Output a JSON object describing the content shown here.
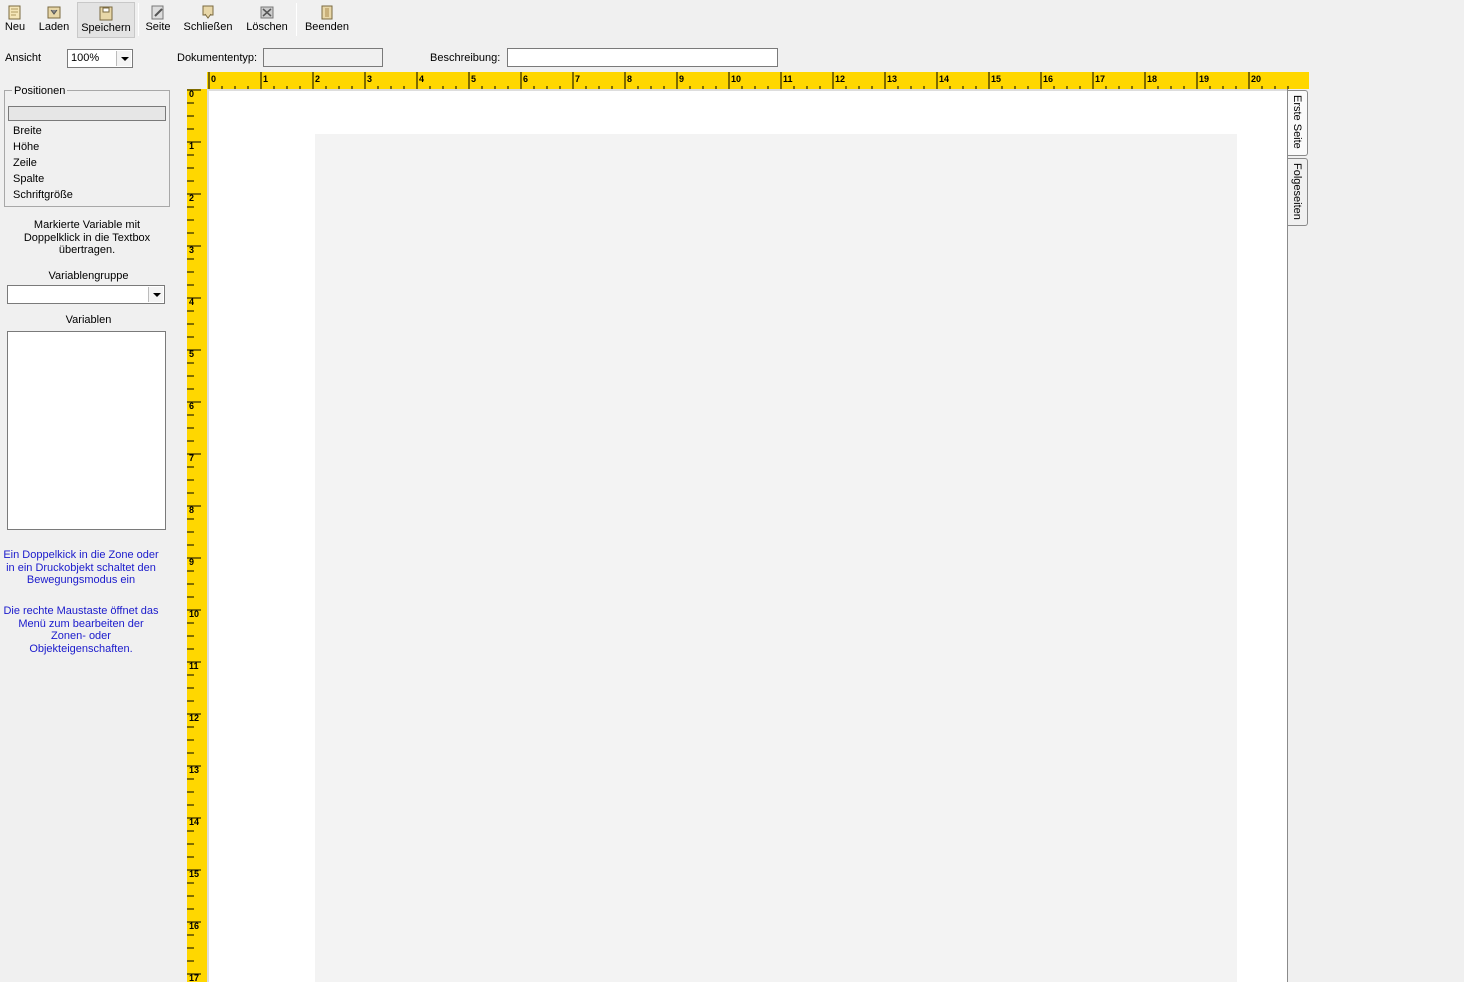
{
  "toolbar": {
    "buttons": [
      {
        "label": "Neu",
        "icon": "new-document-icon"
      },
      {
        "label": "Laden",
        "icon": "load-folder-icon"
      },
      {
        "label": "Speichern",
        "icon": "save-icon"
      },
      {
        "label": "Seite",
        "icon": "page-edit-icon"
      },
      {
        "label": "Schließen",
        "icon": "close-document-icon"
      },
      {
        "label": "Löschen",
        "icon": "delete-icon"
      },
      {
        "label": "Beenden",
        "icon": "exit-door-icon"
      }
    ]
  },
  "fields": {
    "ansicht_label": "Ansicht",
    "ansicht_value": "100%",
    "dokumenttyp_label": "Dokumententyp:",
    "beschreibung_label": "Beschreibung:"
  },
  "sidebar": {
    "positionen_title": "Positionen",
    "props": [
      "Breite",
      "Höhe",
      "Zeile",
      "Spalte",
      "Schriftgröße"
    ],
    "hint_variable": "Markierte Variable mit Doppelklick in die Textbox übertragen.",
    "variablengruppe_label": "Variablengruppe",
    "variablen_label": "Variablen",
    "hint_zone": "Ein Doppelkick in die Zone oder in ein Druckobjekt schaltet den Bewegungsmodus ein",
    "hint_rightclick": "Die rechte Maustaste öffnet das Menü zum bearbeiten der Zonen- oder Objekteigenschaften."
  },
  "ruler": {
    "horizontal": [
      "0",
      "1",
      "2",
      "3",
      "4",
      "5",
      "6",
      "7",
      "8",
      "9",
      "10",
      "11",
      "12",
      "13",
      "14",
      "15",
      "16",
      "17",
      "18",
      "19",
      "20"
    ],
    "vertical": [
      "0",
      "1",
      "2",
      "3",
      "4",
      "5",
      "6",
      "7",
      "8",
      "9",
      "10",
      "11",
      "12",
      "13",
      "14",
      "15",
      "16",
      "17"
    ]
  },
  "tabs": [
    "Erste Seite",
    "Folgeseiten"
  ],
  "colors": {
    "ruler": "#ffd700",
    "hint_text": "#1a1acc"
  }
}
